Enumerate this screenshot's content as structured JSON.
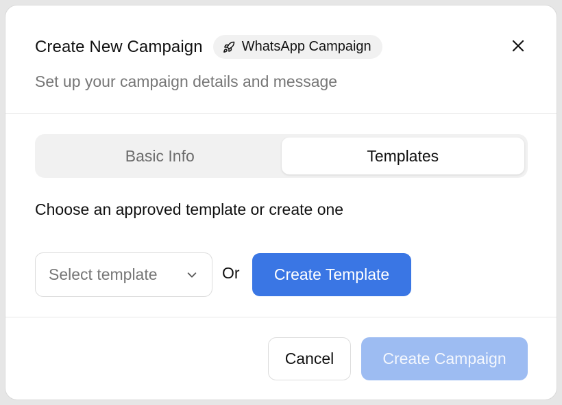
{
  "dialog": {
    "title": "Create New Campaign",
    "badge": {
      "label": "WhatsApp Campaign",
      "icon": "rocket-icon"
    },
    "subtitle": "Set up your campaign details and message",
    "close_icon": "close-icon"
  },
  "tabs": [
    {
      "label": "Basic Info",
      "active": false
    },
    {
      "label": "Templates",
      "active": true
    }
  ],
  "templates_panel": {
    "prompt": "Choose an approved template or create one",
    "select": {
      "placeholder": "Select template",
      "icon": "chevron-down-icon"
    },
    "or_text": "Or",
    "create_template_label": "Create Template"
  },
  "footer": {
    "cancel_label": "Cancel",
    "create_campaign_label": "Create Campaign",
    "create_campaign_disabled": true
  },
  "colors": {
    "primary": "#3a76e4",
    "primary_disabled": "#9dbcf2",
    "muted_text": "#767676"
  }
}
